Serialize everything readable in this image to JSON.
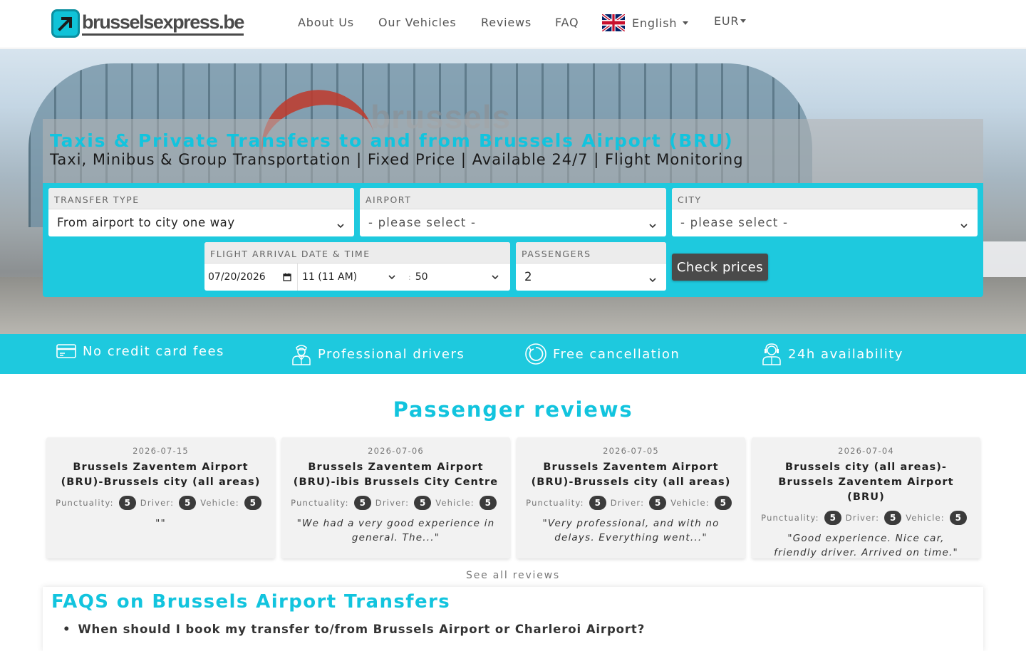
{
  "brand": {
    "name": "brusselsexpress.be"
  },
  "nav": {
    "about": "About Us",
    "vehicles": "Our Vehicles",
    "reviews": "Reviews",
    "faq": "FAQ",
    "language": "English",
    "currency": "EUR"
  },
  "hero": {
    "title": "Taxis & Private Transfers to and from Brussels Airport (BRU)",
    "subtitle": "Taxi, Minibus & Group Transportation | Fixed Price | Available 24/7 | Flight Monitoring",
    "background_sign": "brussels"
  },
  "booking": {
    "transfer_type": {
      "label": "TRANSFER TYPE",
      "value": "From airport to city one way"
    },
    "airport": {
      "label": "AIRPORT",
      "value": "- please select -"
    },
    "city": {
      "label": "CITY",
      "value": "- please select -"
    },
    "flight": {
      "label": "FLIGHT ARRIVAL DATE & TIME",
      "date": "07/20/2026",
      "hour": "11 (11 AM)",
      "separator": ":",
      "minute": "50"
    },
    "passengers": {
      "label": "PASSENGERS",
      "value": "2"
    },
    "submit": "Check prices"
  },
  "features": [
    {
      "icon": "credit-card-icon",
      "label": "No credit card fees"
    },
    {
      "icon": "driver-icon",
      "label": "Professional drivers"
    },
    {
      "icon": "cancel-circle-icon",
      "label": "Free cancellation"
    },
    {
      "icon": "support-agent-icon",
      "label": "24h availability"
    }
  ],
  "reviews": {
    "title": "Passenger reviews",
    "score_labels": {
      "punctuality": "Punctuality:",
      "driver": "Driver:",
      "vehicle": "Vehicle:"
    },
    "items": [
      {
        "date": "2026-07-15",
        "route": "Brussels Zaventem Airport (BRU)-Brussels city (all areas)",
        "punctuality": "5",
        "driver": "5",
        "vehicle": "5",
        "text": "\"\""
      },
      {
        "date": "2026-07-06",
        "route": "Brussels Zaventem Airport (BRU)-ibis Brussels City Centre",
        "punctuality": "5",
        "driver": "5",
        "vehicle": "5",
        "text": "\"We had a very good experience in general. The...\""
      },
      {
        "date": "2026-07-05",
        "route": "Brussels Zaventem Airport (BRU)-Brussels city (all areas)",
        "punctuality": "5",
        "driver": "5",
        "vehicle": "5",
        "text": "\"Very professional, and with no delays. Everything went...\""
      },
      {
        "date": "2026-07-04",
        "route": "Brussels city (all areas)-Brussels Zaventem Airport (BRU)",
        "punctuality": "5",
        "driver": "5",
        "vehicle": "5",
        "text": "\"Good experience. Nice car, friendly driver. Arrived on time.\""
      }
    ],
    "see_all": "See all reviews"
  },
  "faq": {
    "title": "FAQS on Brussels Airport Transfers",
    "items": [
      "When should I book my transfer to/from Brussels Airport or Charleroi Airport?"
    ]
  },
  "colors": {
    "accent": "#1ec9de",
    "title": "#12c4de",
    "button": "#4a4a4a"
  }
}
